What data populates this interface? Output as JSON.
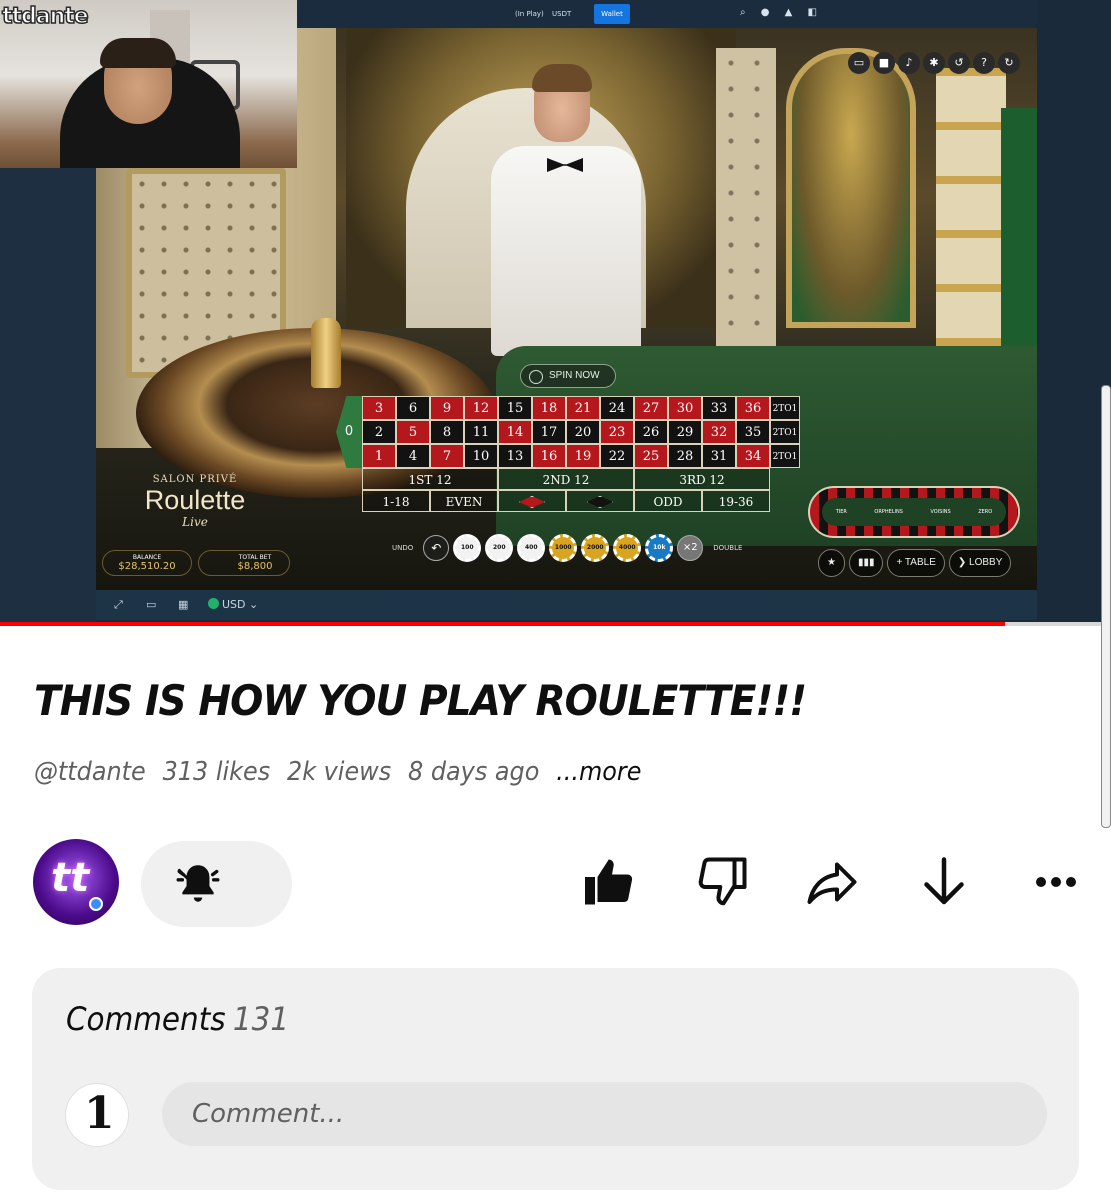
{
  "video": {
    "site_bar": {
      "in_play": "(In Play)",
      "currency": "USDT",
      "wallet_button": "Wallet"
    },
    "facecam_label": "ttdante",
    "spin_button": "SPIN NOW",
    "grid": {
      "zero": "0",
      "rows": [
        [
          {
            "n": "3",
            "c": "red"
          },
          {
            "n": "6",
            "c": "black"
          },
          {
            "n": "9",
            "c": "red"
          },
          {
            "n": "12",
            "c": "red"
          },
          {
            "n": "15",
            "c": "black"
          },
          {
            "n": "18",
            "c": "red"
          },
          {
            "n": "21",
            "c": "red"
          },
          {
            "n": "24",
            "c": "black"
          },
          {
            "n": "27",
            "c": "red"
          },
          {
            "n": "30",
            "c": "red"
          },
          {
            "n": "33",
            "c": "black"
          },
          {
            "n": "36",
            "c": "red"
          }
        ],
        [
          {
            "n": "2",
            "c": "black"
          },
          {
            "n": "5",
            "c": "red"
          },
          {
            "n": "8",
            "c": "black"
          },
          {
            "n": "11",
            "c": "black"
          },
          {
            "n": "14",
            "c": "red"
          },
          {
            "n": "17",
            "c": "black"
          },
          {
            "n": "20",
            "c": "black"
          },
          {
            "n": "23",
            "c": "red"
          },
          {
            "n": "26",
            "c": "black"
          },
          {
            "n": "29",
            "c": "black"
          },
          {
            "n": "32",
            "c": "red"
          },
          {
            "n": "35",
            "c": "black"
          }
        ],
        [
          {
            "n": "1",
            "c": "red"
          },
          {
            "n": "4",
            "c": "black"
          },
          {
            "n": "7",
            "c": "red"
          },
          {
            "n": "10",
            "c": "black"
          },
          {
            "n": "13",
            "c": "black"
          },
          {
            "n": "16",
            "c": "red"
          },
          {
            "n": "19",
            "c": "red"
          },
          {
            "n": "22",
            "c": "black"
          },
          {
            "n": "25",
            "c": "red"
          },
          {
            "n": "28",
            "c": "black"
          },
          {
            "n": "31",
            "c": "black"
          },
          {
            "n": "34",
            "c": "red"
          }
        ]
      ],
      "column_bet": "2TO1",
      "dozens": [
        "1ST 12",
        "2ND 12",
        "3RD 12"
      ],
      "outside": [
        "1-18",
        "EVEN",
        "",
        "",
        "ODD",
        "19-36"
      ]
    },
    "racetrack": {
      "sections": [
        "TIER",
        "ORPHELINS",
        "VOISINS",
        "ZERO"
      ]
    },
    "brand": {
      "top": "SALON PRIVÉ",
      "name": "Roulette",
      "sub": "Live"
    },
    "balance": {
      "label": "BALANCE",
      "value": "$28,510.20"
    },
    "total_bet": {
      "label": "TOTAL BET",
      "value": "$8,800"
    },
    "undo_label": "UNDO",
    "double_label": "DOUBLE",
    "double_symbol": "×2",
    "chips": [
      {
        "label": "100",
        "color": "#f2f2f2"
      },
      {
        "label": "200",
        "color": "#f2f2f2"
      },
      {
        "label": "400",
        "color": "#f2f2f2"
      },
      {
        "label": "1000",
        "color": "#d9a520"
      },
      {
        "label": "2000",
        "color": "#d9a520"
      },
      {
        "label": "4000",
        "color": "#d9a520"
      },
      {
        "label": "10k",
        "color": "#1a79c4"
      }
    ],
    "game_buttons": {
      "table": "TABLE",
      "lobby": "LOBBY"
    },
    "player_bar": {
      "currency": "USD"
    },
    "progress": 0.905
  },
  "info": {
    "title": "THIS IS HOW YOU PLAY ROULETTE!!!",
    "channel_handle": "@ttdante",
    "likes": "313 likes",
    "views": "2k views",
    "age": "8 days ago",
    "more": "...more"
  },
  "comments": {
    "label": "Comments",
    "count": "131",
    "placeholder": "Comment..."
  },
  "colors": {
    "red": "#b5181c",
    "black": "#121212",
    "progress": "#ff0000"
  }
}
